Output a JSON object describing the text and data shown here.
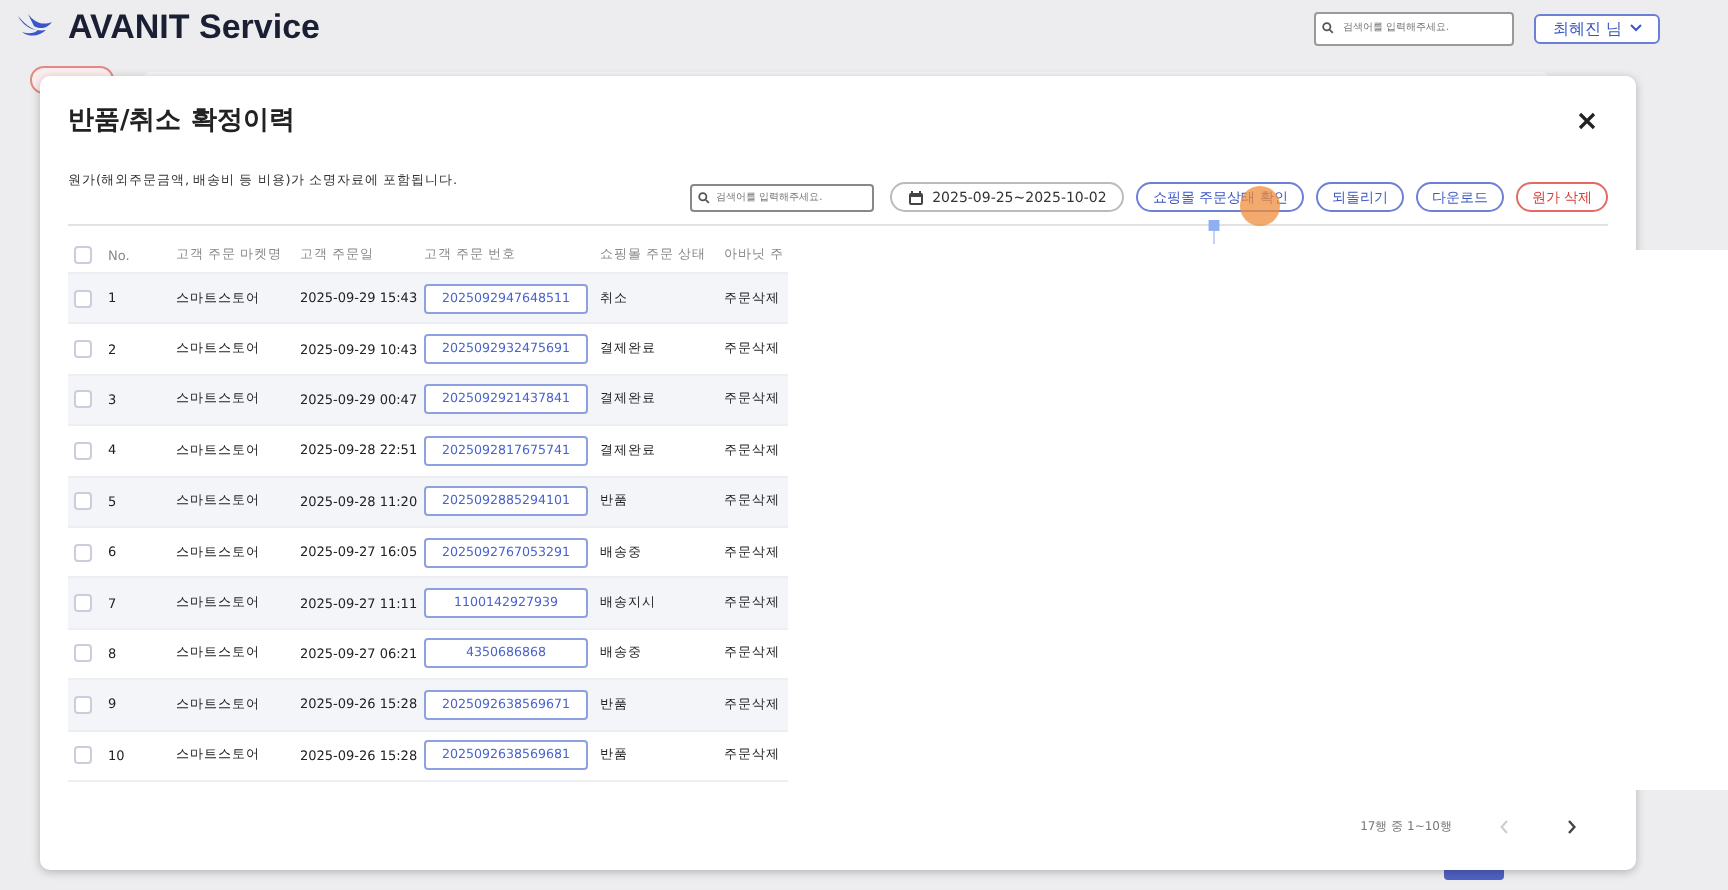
{
  "app": {
    "title": "AVANIT Service",
    "search": {
      "placeholder": "검색어를 입력해주세요."
    },
    "user_button": "최혜진 님"
  },
  "dialog": {
    "title": "반품/취소 확정이력",
    "note": "원가(해외주문금액, 배송비 등 비용)가 소명자료에 포함됩니다.",
    "search": {
      "placeholder": "검색어를 입력해주세요."
    },
    "date_range": "2025-09-25~2025-10-02",
    "buttons": [
      {
        "label": "쇼핑몰 주문상태 확인",
        "kind": "primary"
      },
      {
        "label": "되돌리기",
        "kind": "primary"
      },
      {
        "label": "다운로드",
        "kind": "primary"
      },
      {
        "label": "원가 삭제",
        "kind": "danger"
      }
    ],
    "table": {
      "all_selected": false,
      "columns": [
        "No.",
        "고객 주문 마켓명",
        "고객 주문일",
        "고객 주문 번호",
        "쇼핑몰 주문 상태",
        "아바닛 주"
      ],
      "rows": [
        {
          "selected": false,
          "no": "1",
          "market": "스마트스토어",
          "date": "2025-09-29 15:43",
          "order_no": "2025092947648511",
          "shop_status": "취소",
          "avanit_status": "주문삭제"
        },
        {
          "selected": false,
          "no": "2",
          "market": "스마트스토어",
          "date": "2025-09-29 10:43",
          "order_no": "2025092932475691",
          "shop_status": "결제완료",
          "avanit_status": "주문삭제"
        },
        {
          "selected": false,
          "no": "3",
          "market": "스마트스토어",
          "date": "2025-09-29 00:47",
          "order_no": "2025092921437841",
          "shop_status": "결제완료",
          "avanit_status": "주문삭제"
        },
        {
          "selected": false,
          "no": "4",
          "market": "스마트스토어",
          "date": "2025-09-28 22:51",
          "order_no": "2025092817675741",
          "shop_status": "결제완료",
          "avanit_status": "주문삭제"
        },
        {
          "selected": false,
          "no": "5",
          "market": "스마트스토어",
          "date": "2025-09-28 11:20",
          "order_no": "2025092885294101",
          "shop_status": "반품",
          "avanit_status": "주문삭제"
        },
        {
          "selected": false,
          "no": "6",
          "market": "스마트스토어",
          "date": "2025-09-27 16:05",
          "order_no": "2025092767053291",
          "shop_status": "배송중",
          "avanit_status": "주문삭제"
        },
        {
          "selected": false,
          "no": "7",
          "market": "스마트스토어",
          "date": "2025-09-27 11:11",
          "order_no": "1100142927939",
          "shop_status": "배송지시",
          "avanit_status": "주문삭제"
        },
        {
          "selected": false,
          "no": "8",
          "market": "스마트스토어",
          "date": "2025-09-27 06:21",
          "order_no": "4350686868",
          "shop_status": "배송중",
          "avanit_status": "주문삭제"
        },
        {
          "selected": false,
          "no": "9",
          "market": "스마트스토어",
          "date": "2025-09-26 15:28",
          "order_no": "2025092638569671",
          "shop_status": "반품",
          "avanit_status": "주문삭제"
        },
        {
          "selected": false,
          "no": "10",
          "market": "스마트스토어",
          "date": "2025-09-26 15:28",
          "order_no": "2025092638569681",
          "shop_status": "반품",
          "avanit_status": "주문삭제"
        }
      ]
    },
    "pagination": {
      "summary": "17행 중 1~10행",
      "prev_disabled": true,
      "next_disabled": false
    }
  }
}
